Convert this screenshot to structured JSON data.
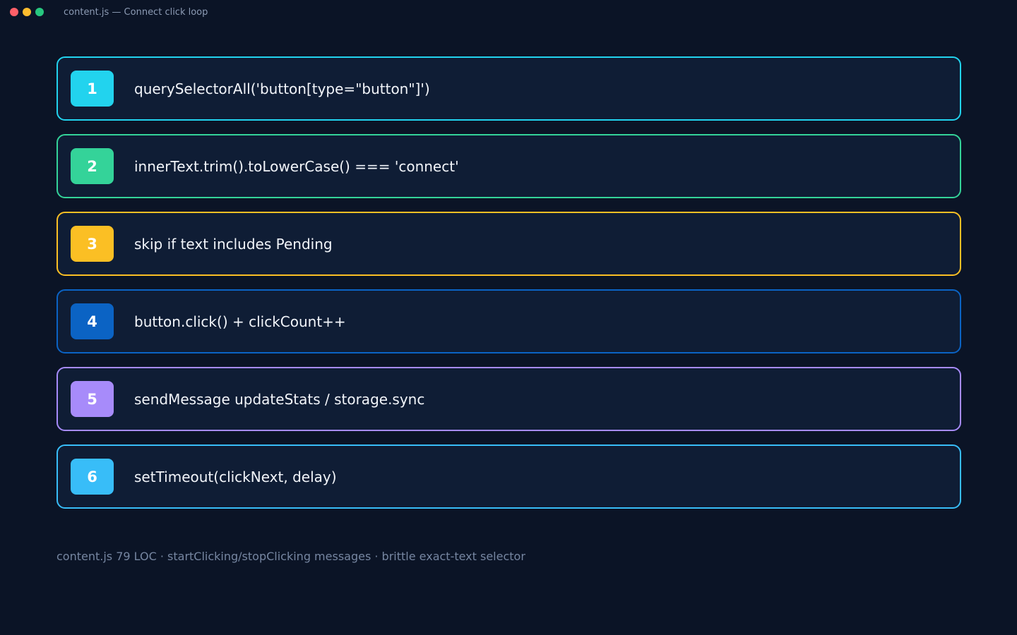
{
  "window": {
    "title": "content.js — Connect click loop",
    "controls": [
      "close",
      "minimize",
      "maximize"
    ]
  },
  "steps": [
    {
      "number": "1",
      "label": "querySelectorAll('button[type=\"button\"]')",
      "color": "#22d3ee"
    },
    {
      "number": "2",
      "label": "innerText.trim().toLowerCase() === 'connect'",
      "color": "#34d399"
    },
    {
      "number": "3",
      "label": "skip if text includes Pending",
      "color": "#fbbf24"
    },
    {
      "number": "4",
      "label": "button.click() + clickCount++",
      "color": "#0b63c4"
    },
    {
      "number": "5",
      "label": "sendMessage updateStats / storage.sync",
      "color": "#a78bfa"
    },
    {
      "number": "6",
      "label": "setTimeout(clickNext, delay)",
      "color": "#38bdf8"
    }
  ],
  "footer": {
    "text": "content.js 79 LOC · startClicking/stopClicking messages · brittle exact-text selector"
  },
  "colors": {
    "background": "#0b1426",
    "card": "#0f1d35",
    "text": "#f2f5fa",
    "muted": "#7686a1"
  }
}
